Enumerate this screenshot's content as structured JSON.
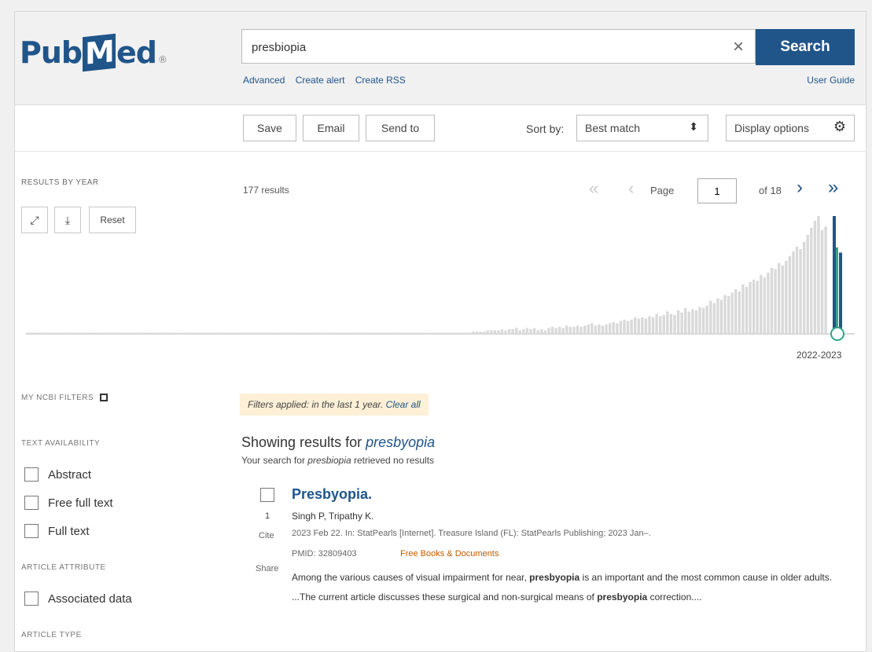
{
  "header": {
    "logo_text_1": "Pub",
    "logo_m": "M",
    "logo_text_2": "ed",
    "logo_mark": "®",
    "search_value": "presbiopia",
    "clear_icon": "×",
    "search_label": "Search",
    "links": {
      "advanced": "Advanced",
      "create_alert": "Create alert",
      "create_rss": "Create RSS"
    },
    "user_guide": "User Guide"
  },
  "toolbar": {
    "save": "Save",
    "email": "Email",
    "send_to": "Send to",
    "sort_label": "Sort by:",
    "sort_value": "Best match",
    "sort_arrows": "⬍",
    "display_options": "Display options",
    "gear_glyph": "⚙"
  },
  "timeline": {
    "title": "RESULTS BY YEAR",
    "expand_glyph": "⤢",
    "download_glyph": "⤓",
    "reset": "Reset",
    "results_count": "177 results",
    "pager": {
      "first": "«",
      "prev": "‹",
      "page_label": "Page",
      "page_value": "1",
      "of_pages": "of 18",
      "next": "›",
      "last": "»"
    },
    "year_range": "2022-2023"
  },
  "chart_data": {
    "type": "bar",
    "note_colors": {
      "bars": "#d9d9d9",
      "selected": "#20558a",
      "handle": "#2fa58a"
    },
    "values": [
      1,
      1,
      1,
      1,
      1,
      1,
      1,
      1,
      1,
      1,
      1,
      1,
      1,
      1,
      1,
      1,
      1,
      1,
      1,
      1,
      1,
      1,
      1,
      1,
      1,
      1,
      1,
      1,
      1,
      1,
      1,
      1,
      1,
      1,
      1,
      1,
      1,
      1,
      1,
      1,
      1,
      1,
      1,
      1,
      1,
      1,
      1,
      1,
      1,
      1,
      1,
      1,
      1,
      1,
      1,
      1,
      1,
      1,
      1,
      1,
      1,
      1,
      1,
      1,
      1,
      1,
      1,
      1,
      1,
      1,
      1,
      1,
      1,
      1,
      1,
      1,
      1,
      1,
      1,
      1,
      1,
      1,
      1,
      1,
      1,
      1,
      1,
      1,
      1,
      1,
      1,
      1,
      1,
      1,
      1,
      1,
      1,
      1,
      1,
      1,
      1,
      1,
      1,
      1,
      1,
      1,
      1,
      1,
      1,
      1,
      1,
      1,
      1,
      1,
      1,
      1,
      1,
      1,
      1,
      1,
      1,
      1,
      1,
      1,
      2,
      2,
      2,
      2,
      3,
      3,
      3,
      3,
      4,
      3,
      4,
      4,
      5,
      3,
      4,
      5,
      4,
      5,
      3,
      4,
      3,
      5,
      6,
      5,
      6,
      5,
      7,
      6,
      6,
      7,
      6,
      7,
      8,
      9,
      7,
      8,
      7,
      8,
      9,
      10,
      9,
      11,
      12,
      11,
      12,
      14,
      13,
      14,
      13,
      15,
      14,
      17,
      15,
      16,
      19,
      17,
      16,
      20,
      18,
      22,
      19,
      21,
      20,
      23,
      22,
      24,
      28,
      26,
      30,
      29,
      33,
      32,
      35,
      38,
      36,
      42,
      40,
      44,
      46,
      45,
      50,
      48,
      52,
      56,
      55,
      60,
      58,
      62,
      66,
      70,
      74,
      72,
      78,
      84,
      90,
      96,
      100,
      88,
      91
    ],
    "selected_values": [
      100,
      69
    ]
  },
  "sidebar": {
    "my_ncbi_filters": "MY NCBI FILTERS",
    "text_availability": "TEXT AVAILABILITY",
    "abstract": "Abstract",
    "free_full_text": "Free full text",
    "full_text": "Full text",
    "article_attribute": "ARTICLE ATTRIBUTE",
    "associated_data": "Associated data",
    "article_type": "ARTICLE TYPE"
  },
  "results": {
    "filters_note": "Filters applied: in the last 1 year.",
    "clear_all": "Clear all",
    "showing_prefix": "Showing results for",
    "showing_term": "presbyopia",
    "no_results_prefix": "Your search for",
    "no_results_term": "presbiopia",
    "no_results_suffix": "retrieved no results",
    "item": {
      "number": "1",
      "cite": "Cite",
      "share": "Share",
      "title": "Presbyopia.",
      "authors": "Singh P, Tripathy K.",
      "citation": "2023 Feb 22. In: StatPearls [Internet]. Treasure Island (FL): StatPearls Publishing; 2023 Jan–.",
      "pmid": "PMID: 32809403",
      "free": "Free Books & Documents",
      "snippet_1": "Among the various causes of visual impairment for near,",
      "snippet_bold_1": "presbyopia",
      "snippet_2": "is an important and the most common cause in older adults. ...The current article discusses these surgical and non-surgical means of",
      "snippet_bold_2": "presbyopia",
      "snippet_3": "correction...."
    }
  }
}
